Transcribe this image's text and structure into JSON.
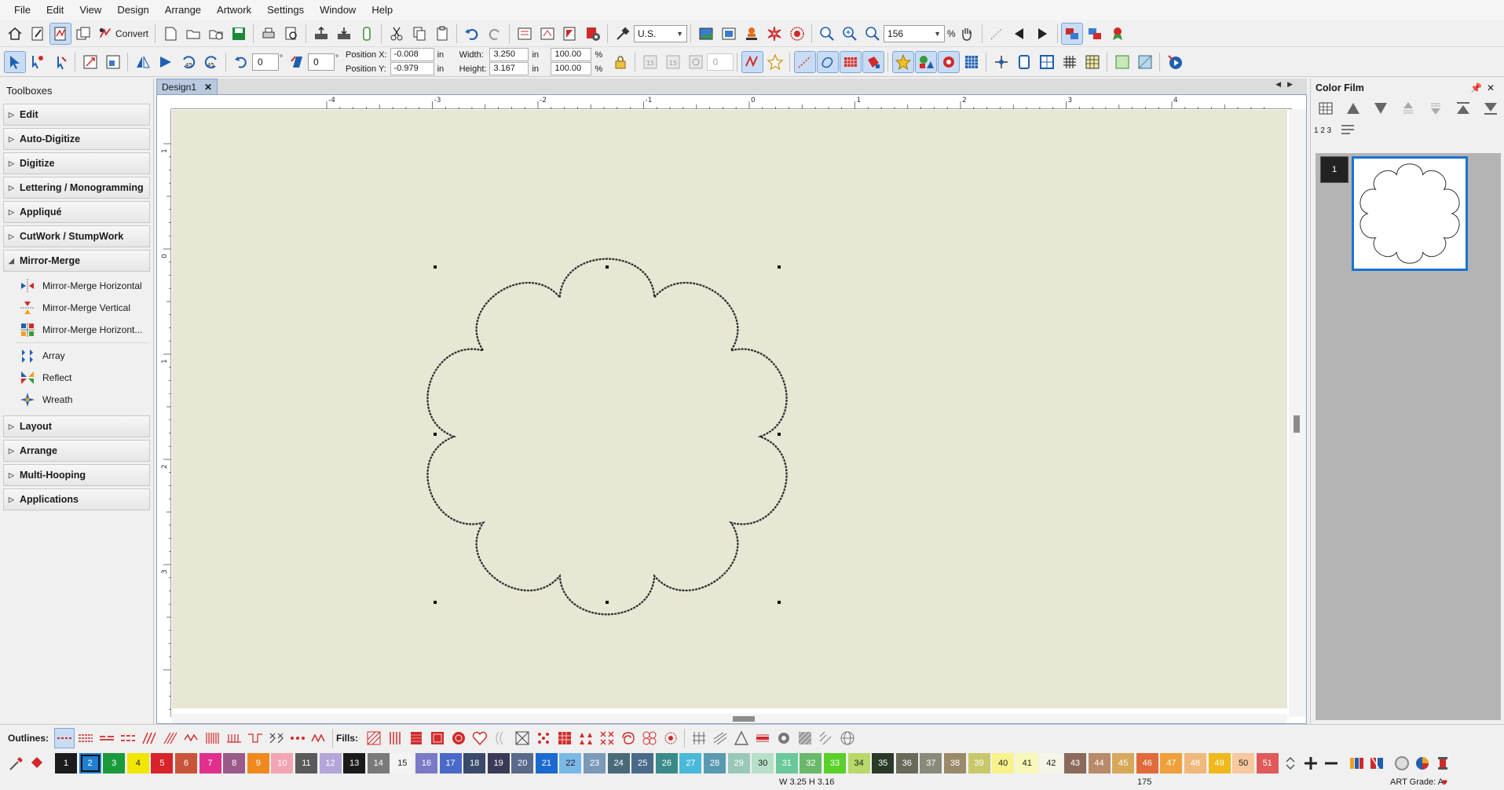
{
  "menu": [
    "File",
    "Edit",
    "View",
    "Design",
    "Arrange",
    "Artwork",
    "Settings",
    "Window",
    "Help"
  ],
  "toolbar1": {
    "convert_label": "Convert",
    "units_value": "U.S.",
    "zoom_value": "156",
    "zoom_unit": "%"
  },
  "toolbar2": {
    "rotate_value": "0",
    "slant_value": "0",
    "deg": "°",
    "position_x_label": "Position X:",
    "position_x_value": "-0.008",
    "position_y_label": "Position Y:",
    "position_y_value": "-0.979",
    "unit": "in",
    "width_label": "Width:",
    "width_value": "3.250",
    "height_label": "Height:",
    "height_value": "3.167",
    "width_pct": "100.00",
    "height_pct": "100.00",
    "pct": "%",
    "disabled_spin_value": "0"
  },
  "toolboxes": {
    "title": "Toolboxes",
    "groups_top": [
      "Edit",
      "Auto-Digitize",
      "Digitize",
      "Lettering / Monogramming",
      "Appliqué",
      "CutWork / StumpWork"
    ],
    "open_group": "Mirror-Merge",
    "mirror_items": [
      "Mirror-Merge Horizontal",
      "Mirror-Merge Vertical",
      "Mirror-Merge Horizont..."
    ],
    "mirror_items2": [
      "Array",
      "Reflect",
      "Wreath"
    ],
    "groups_bottom": [
      "Layout",
      "Arrange",
      "Multi-Hooping",
      "Applications"
    ]
  },
  "document": {
    "tab_label": "Design1",
    "ruler_h_labels": [
      "-4",
      "-3",
      "-2",
      "-1",
      "0",
      "1",
      "2",
      "3",
      "4"
    ],
    "ruler_v_labels": [
      "1",
      "0",
      "1",
      "2",
      "3"
    ]
  },
  "color_film": {
    "title": "Color Film",
    "item_number": "1",
    "seq_label": "1 2 3"
  },
  "stitchbar": {
    "outlines_label": "Outlines:",
    "fills_label": "Fills:"
  },
  "palette": {
    "swatches": [
      {
        "n": "1",
        "c": "#1c1c1c"
      },
      {
        "n": "2",
        "c": "#1f7fd0"
      },
      {
        "n": "3",
        "c": "#1a9a3a"
      },
      {
        "n": "4",
        "c": "#f2e600",
        "t": "dark"
      },
      {
        "n": "5",
        "c": "#d8232a"
      },
      {
        "n": "6",
        "c": "#c8553a"
      },
      {
        "n": "7",
        "c": "#e0308c"
      },
      {
        "n": "8",
        "c": "#9a5a8a"
      },
      {
        "n": "9",
        "c": "#f08a1e"
      },
      {
        "n": "10",
        "c": "#f2a6b4"
      },
      {
        "n": "11",
        "c": "#5a5a5a"
      },
      {
        "n": "12",
        "c": "#b4a6d8"
      },
      {
        "n": "13",
        "c": "#1a1a1a"
      },
      {
        "n": "14",
        "c": "#7a7a7a"
      },
      {
        "n": "15",
        "c": "#f4f4f4",
        "t": "dark"
      },
      {
        "n": "16",
        "c": "#7a7ac8"
      },
      {
        "n": "17",
        "c": "#4a6ac8"
      },
      {
        "n": "18",
        "c": "#3a4a6a"
      },
      {
        "n": "19",
        "c": "#3a3a58"
      },
      {
        "n": "20",
        "c": "#5a6a8a"
      },
      {
        "n": "21",
        "c": "#1a6ad0"
      },
      {
        "n": "22",
        "c": "#7ab8e8",
        "t": "dark"
      },
      {
        "n": "23",
        "c": "#7a9ab8"
      },
      {
        "n": "24",
        "c": "#4a6a7a"
      },
      {
        "n": "25",
        "c": "#4a6a8a"
      },
      {
        "n": "26",
        "c": "#3a8a8a"
      },
      {
        "n": "27",
        "c": "#4ab8d8"
      },
      {
        "n": "28",
        "c": "#5a9ab0"
      },
      {
        "n": "29",
        "c": "#9ac8b8"
      },
      {
        "n": "30",
        "c": "#b8e0c8",
        "t": "dark"
      },
      {
        "n": "31",
        "c": "#6ac89a"
      },
      {
        "n": "32",
        "c": "#6ab86a"
      },
      {
        "n": "33",
        "c": "#5ad02a"
      },
      {
        "n": "34",
        "c": "#b8d86a",
        "t": "dark"
      },
      {
        "n": "35",
        "c": "#2a3a2a"
      },
      {
        "n": "36",
        "c": "#6a6a5a"
      },
      {
        "n": "37",
        "c": "#8a8a7a"
      },
      {
        "n": "38",
        "c": "#9a8a6a"
      },
      {
        "n": "39",
        "c": "#c8c86a"
      },
      {
        "n": "40",
        "c": "#f8f28a",
        "t": "dark"
      },
      {
        "n": "41",
        "c": "#f8f8b8",
        "t": "dark"
      },
      {
        "n": "42",
        "c": "#f6f6e8",
        "t": "dark"
      },
      {
        "n": "43",
        "c": "#8a6a5a"
      },
      {
        "n": "44",
        "c": "#b88a6a"
      },
      {
        "n": "45",
        "c": "#d8a85a"
      },
      {
        "n": "46",
        "c": "#e06a3a"
      },
      {
        "n": "47",
        "c": "#f0a03a"
      },
      {
        "n": "48",
        "c": "#f0b87a"
      },
      {
        "n": "49",
        "c": "#f0b81a"
      },
      {
        "n": "50",
        "c": "#f8c8a0",
        "t": "dark"
      },
      {
        "n": "51",
        "c": "#e05a5a"
      }
    ]
  },
  "status": {
    "size_text": "W 3.25 H 3.16",
    "count_text": "175",
    "art_grade": "ART Grade: A"
  },
  "colors": {
    "canvas": "#e8e6d4",
    "accent": "#1a73d0",
    "heart": "#d01818"
  }
}
